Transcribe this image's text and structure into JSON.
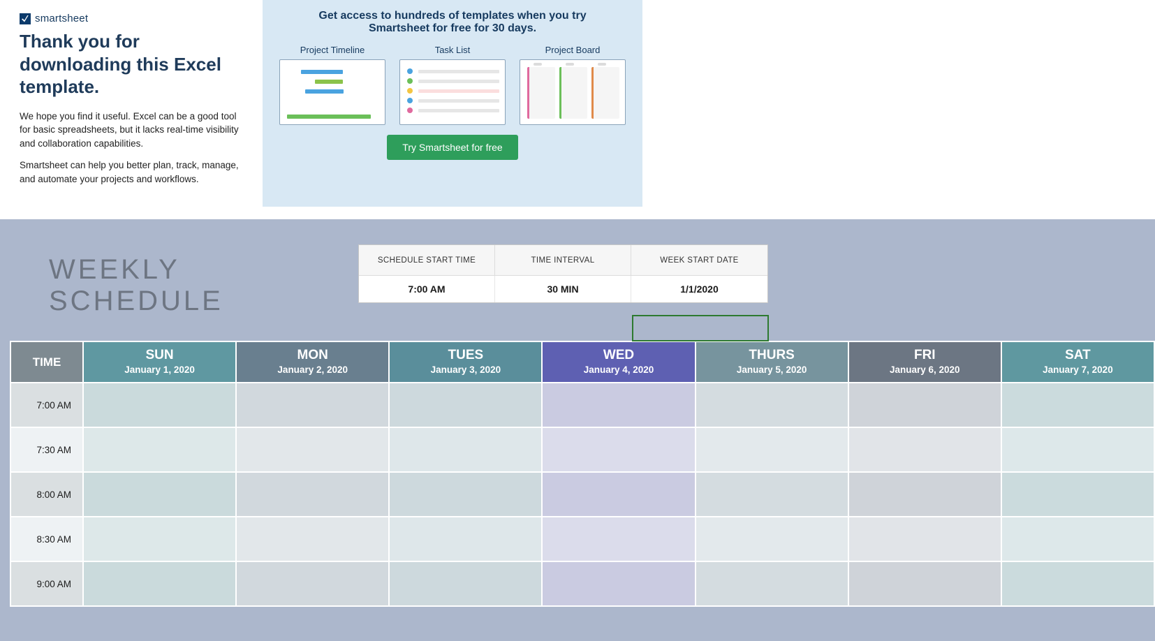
{
  "promo": {
    "logo_text": "smartsheet",
    "thank_title": "Thank you for downloading this Excel template.",
    "body1": "We hope you find it useful. Excel can be a good tool for basic spreadsheets, but it lacks real-time visibility and collaboration capabilities.",
    "body2": "Smartsheet can help you better plan, track, manage, and automate your projects and workflows.",
    "right_headline": "Get access to hundreds of templates when you try Smartsheet for free for 30 days.",
    "cards": {
      "timeline": "Project Timeline",
      "tasklist": "Task List",
      "board": "Project Board"
    },
    "cta": "Try Smartsheet for free"
  },
  "schedule": {
    "title": "WEEKLY SCHEDULE",
    "config": {
      "start_time_label": "SCHEDULE START TIME",
      "start_time_value": "7:00 AM",
      "interval_label": "TIME INTERVAL",
      "interval_value": "30 MIN",
      "week_start_label": "WEEK START DATE",
      "week_start_value": "1/1/2020"
    },
    "time_header": "TIME",
    "days": [
      {
        "short": "SUN",
        "date": "January 1, 2020",
        "cls": "sun"
      },
      {
        "short": "MON",
        "date": "January 2, 2020",
        "cls": "mon"
      },
      {
        "short": "TUES",
        "date": "January 3, 2020",
        "cls": "tue"
      },
      {
        "short": "WED",
        "date": "January 4, 2020",
        "cls": "wed"
      },
      {
        "short": "THURS",
        "date": "January 5, 2020",
        "cls": "thu"
      },
      {
        "short": "FRI",
        "date": "January 6, 2020",
        "cls": "fri"
      },
      {
        "short": "SAT",
        "date": "January 7, 2020",
        "cls": "sat"
      }
    ],
    "times": [
      "7:00 AM",
      "7:30 AM",
      "8:00 AM",
      "8:30 AM",
      "9:00 AM"
    ]
  }
}
